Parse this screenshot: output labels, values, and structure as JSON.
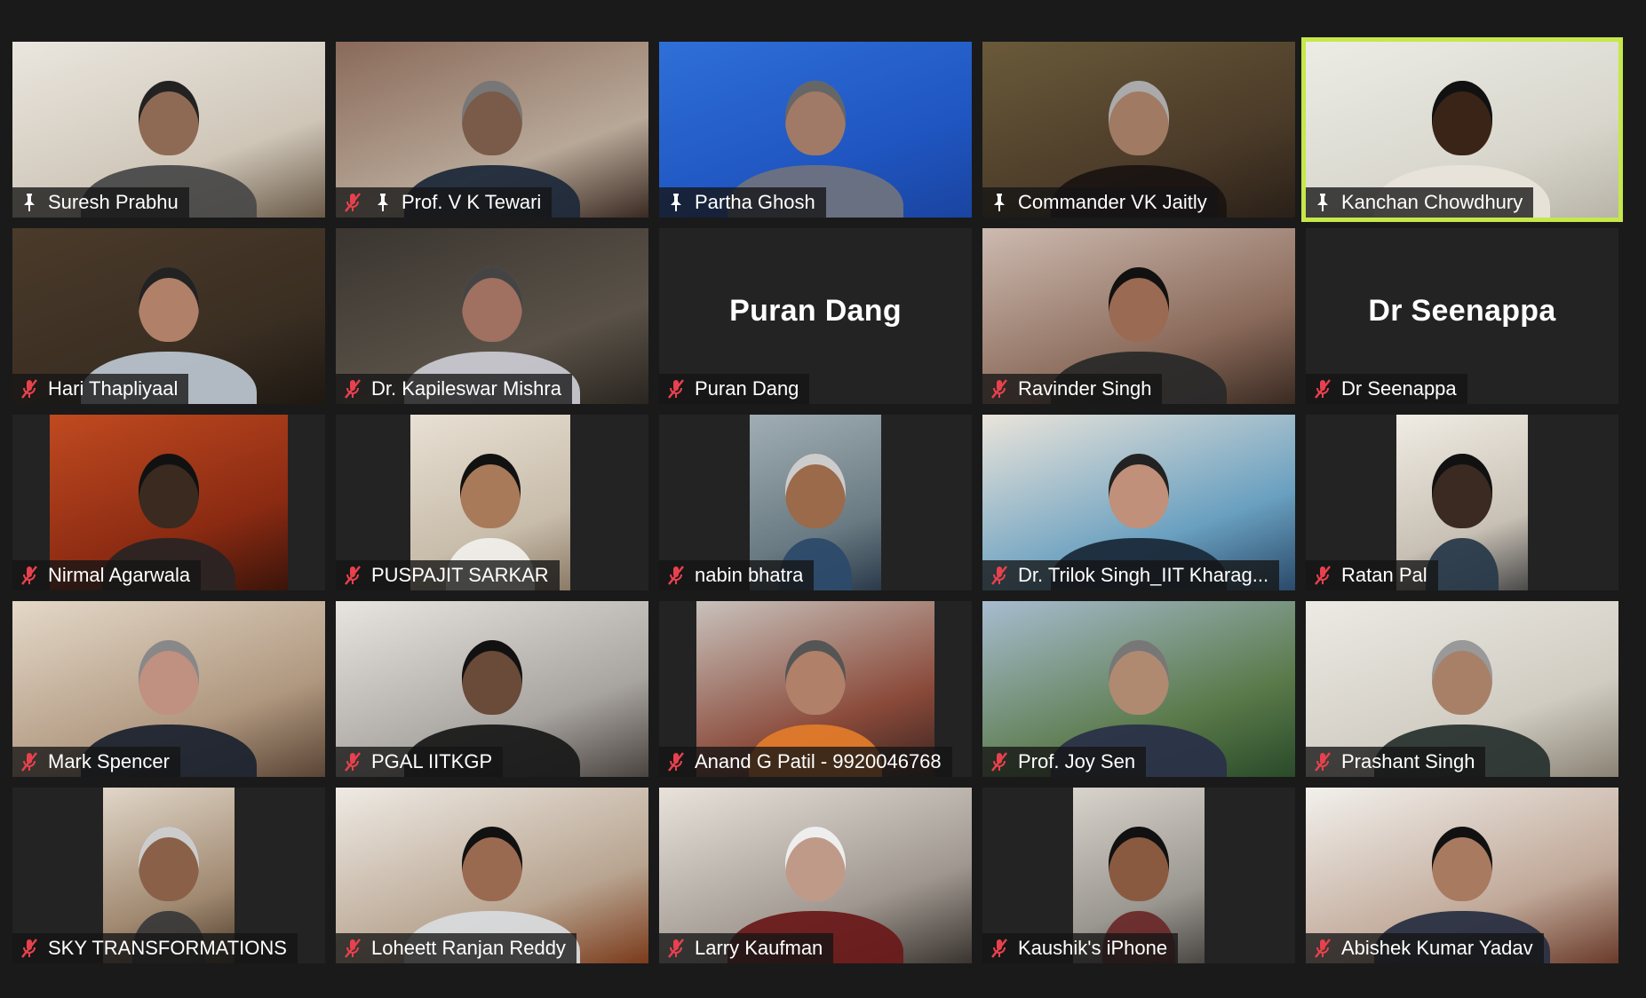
{
  "meeting": {
    "active_speaker": "Kanchan Chowdhury",
    "colors": {
      "active_border": "#c6e84a",
      "muted_icon": "#e8414e",
      "background": "#1a1a1a"
    },
    "participants": [
      {
        "name": "Suresh Prabhu",
        "muted": false,
        "spotlight": true
      },
      {
        "name": "Prof. V K Tewari",
        "muted": true,
        "spotlight": true
      },
      {
        "name": "Partha Ghosh",
        "muted": false,
        "spotlight": true
      },
      {
        "name": "Commander VK Jaitly",
        "muted": false,
        "spotlight": true
      },
      {
        "name": "Kanchan Chowdhury",
        "muted": false,
        "spotlight": true,
        "active": true
      },
      {
        "name": "Hari Thapliyaal",
        "muted": true
      },
      {
        "name": "Dr. Kapileswar Mishra",
        "muted": true
      },
      {
        "name": "Puran Dang",
        "muted": true,
        "video_off": true,
        "display_name": "Puran Dang"
      },
      {
        "name": "Ravinder Singh",
        "muted": true
      },
      {
        "name": "Dr Seenappa",
        "muted": true,
        "video_off": true,
        "display_name": "Dr Seenappa"
      },
      {
        "name": "Nirmal Agarwala",
        "muted": true
      },
      {
        "name": "PUSPAJIT SARKAR",
        "muted": true
      },
      {
        "name": "nabin bhatra",
        "muted": true
      },
      {
        "name": "Dr. Trilok Singh_IIT Kharag...",
        "muted": true
      },
      {
        "name": "Ratan Pal",
        "muted": true
      },
      {
        "name": "Mark Spencer",
        "muted": true
      },
      {
        "name": "PGAL IITKGP",
        "muted": true
      },
      {
        "name": "Anand G Patil - 9920046768",
        "muted": true
      },
      {
        "name": "Prof. Joy Sen",
        "muted": true
      },
      {
        "name": "Prashant Singh",
        "muted": true
      },
      {
        "name": "SKY TRANSFORMATIONS",
        "muted": true
      },
      {
        "name": "Loheett Ranjan Reddy",
        "muted": true
      },
      {
        "name": "Larry Kaufman",
        "muted": true
      },
      {
        "name": "Kaushik's iPhone",
        "muted": true
      },
      {
        "name": "Abishek Kumar Yadav",
        "muted": true
      }
    ]
  }
}
